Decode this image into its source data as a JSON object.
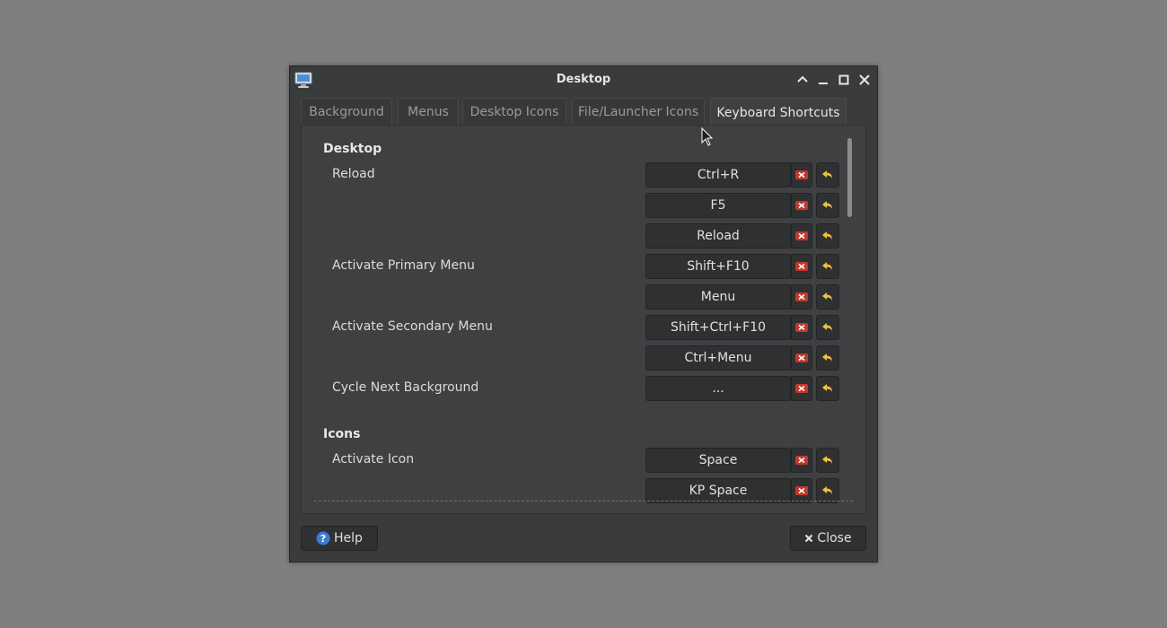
{
  "window": {
    "title": "Desktop"
  },
  "tabs": [
    {
      "label": "Background",
      "active": false
    },
    {
      "label": "Menus",
      "active": false
    },
    {
      "label": "Desktop Icons",
      "active": false
    },
    {
      "label": "File/Launcher Icons",
      "active": false
    },
    {
      "label": "Keyboard Shortcuts",
      "active": true
    }
  ],
  "sections": [
    {
      "title": "Desktop",
      "actions": [
        {
          "label": "Reload",
          "shortcuts": [
            "Ctrl+R",
            "F5",
            "Reload"
          ]
        },
        {
          "label": "Activate Primary Menu",
          "shortcuts": [
            "Shift+F10",
            "Menu"
          ]
        },
        {
          "label": "Activate Secondary Menu",
          "shortcuts": [
            "Shift+Ctrl+F10",
            "Ctrl+Menu"
          ]
        },
        {
          "label": "Cycle Next Background",
          "shortcuts": [
            "..."
          ]
        }
      ]
    },
    {
      "title": "Icons",
      "actions": [
        {
          "label": "Activate Icon",
          "shortcuts": [
            "Space",
            "KP Space"
          ]
        }
      ]
    }
  ],
  "buttons": {
    "help": "Help",
    "close": "Close"
  },
  "icons": {
    "app": "desktop-monitor-icon",
    "clear": "clear-shortcut-icon",
    "undo": "restore-default-icon",
    "help": "help-icon",
    "close": "close-x-icon"
  },
  "colors": {
    "clear_red": "#c0392b",
    "undo_yellow": "#f0c040",
    "help_blue": "#3a7bd5"
  }
}
